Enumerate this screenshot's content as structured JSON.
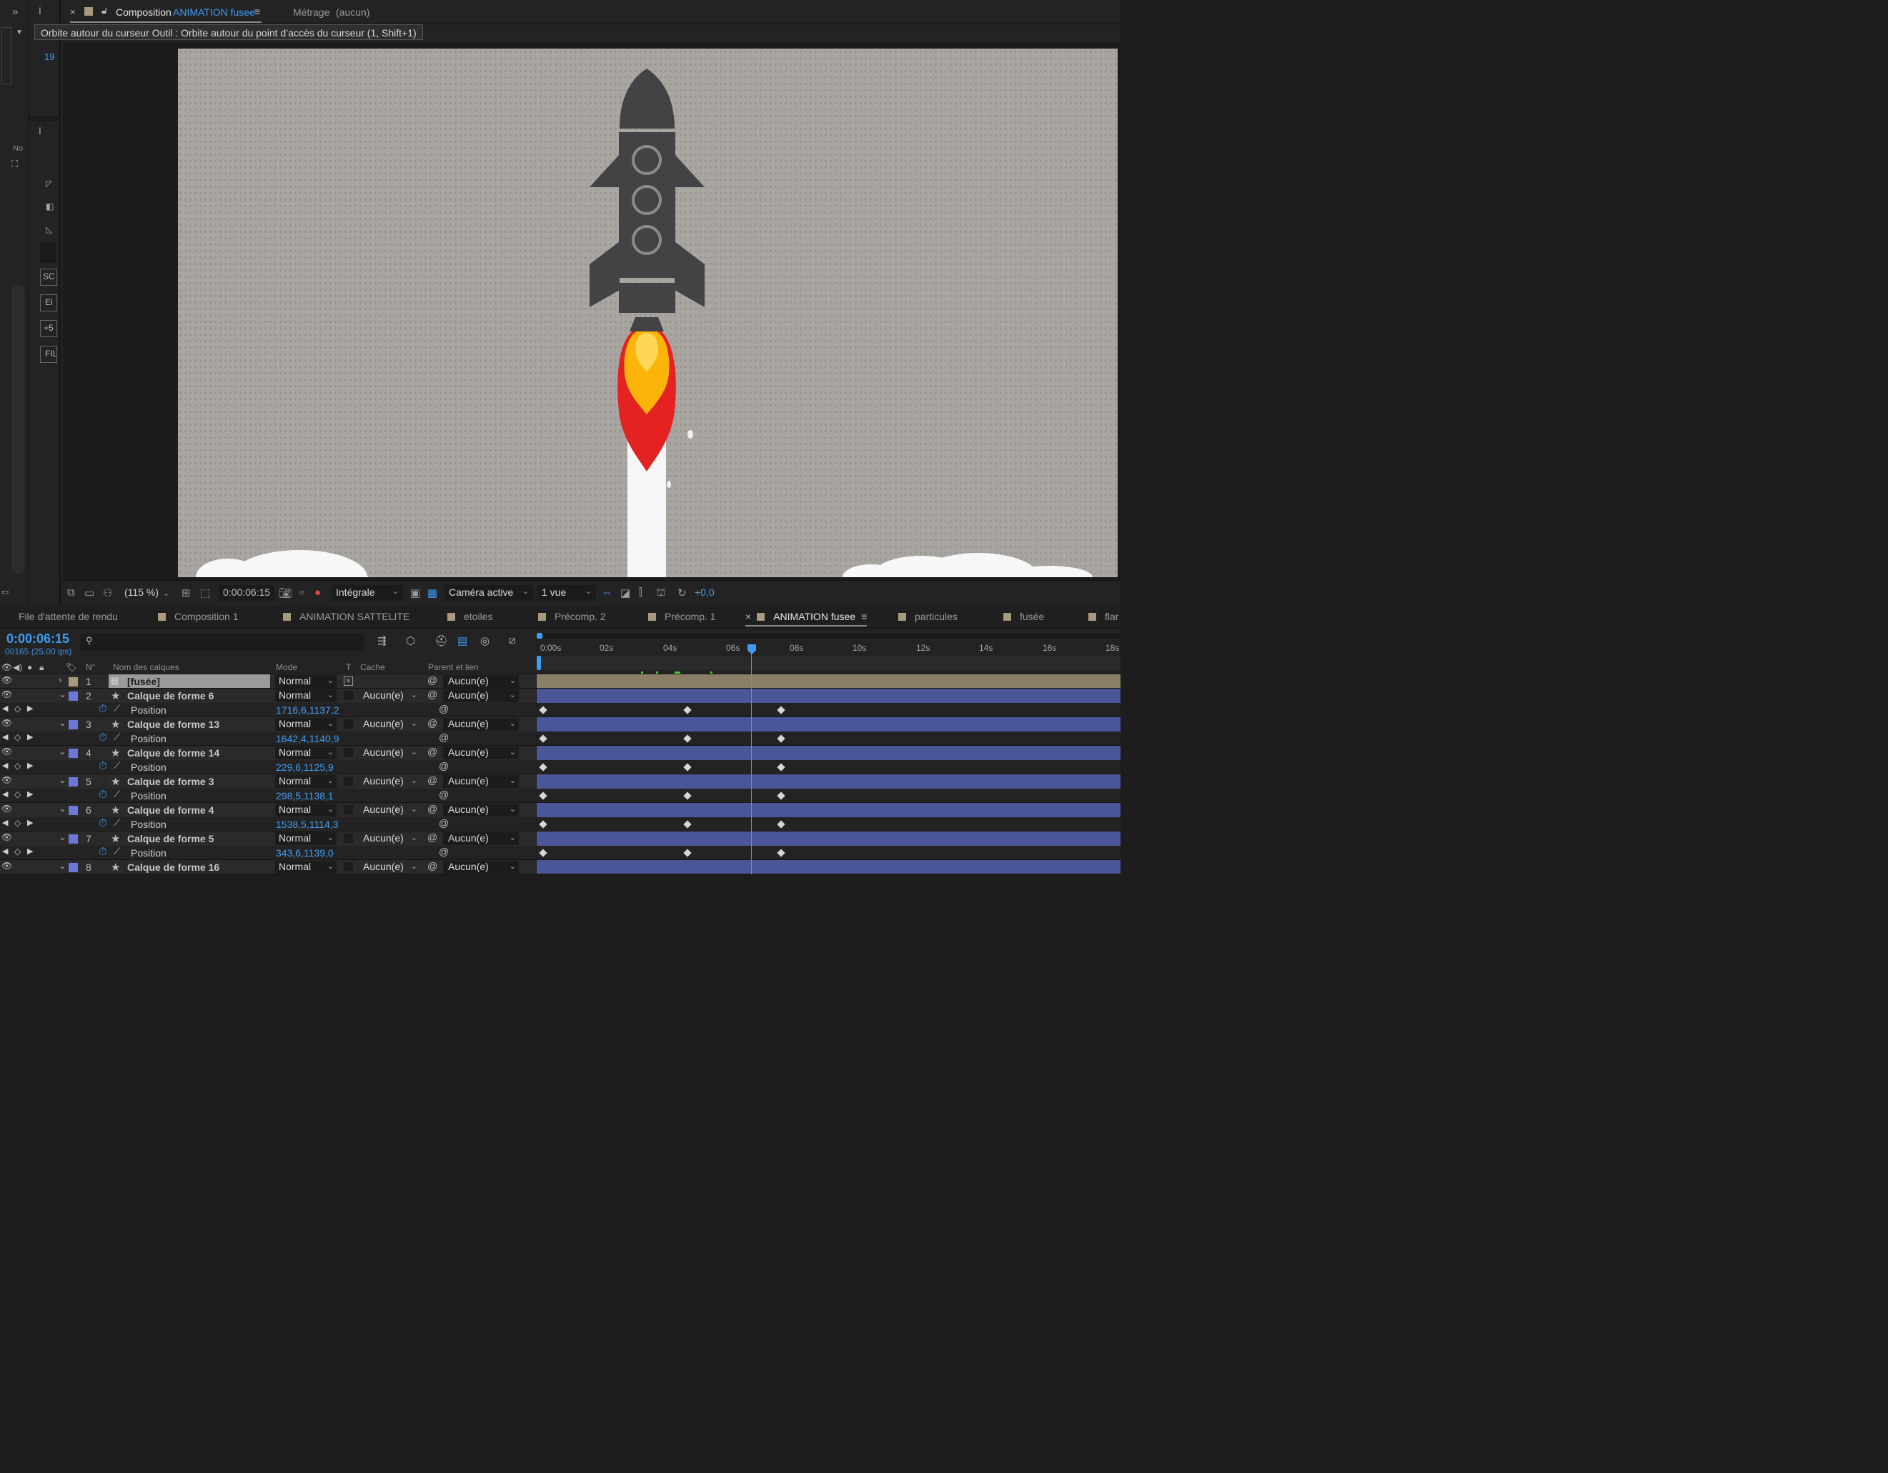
{
  "composition_panel": {
    "tab_prefix": "Composition",
    "tab_name": "ANIMATION fusee",
    "footage_tab": "Métrage",
    "footage_value": "(aucun)",
    "tooltip": "Orbite autour du curseur Outil : Orbite autour du point d’accès du curseur (1, Shift+1)"
  },
  "left_strip": {
    "number": "19",
    "col_label": "No",
    "buttons": [
      "SC",
      "El",
      "+5",
      "FIL"
    ]
  },
  "viewer_toolbar": {
    "zoom": "(115 %)",
    "timecode": "0:00:06:15",
    "resolution": "Intégrale",
    "camera": "Caméra active",
    "views": "1 vue",
    "exposure": "+0,0"
  },
  "timeline_tabs": [
    {
      "label": "File d'attente de rendu"
    },
    {
      "label": "Composition 1"
    },
    {
      "label": "ANIMATION SATTELITE"
    },
    {
      "label": "etoiles"
    },
    {
      "label": "Précomp. 2"
    },
    {
      "label": "Précomp. 1"
    },
    {
      "label": "ANIMATION fusee"
    },
    {
      "label": "particules"
    },
    {
      "label": "fusée"
    },
    {
      "label": "flar"
    }
  ],
  "timeline": {
    "timecode": "0:00:06:15",
    "frames": "00165 (25.00 ips)",
    "headers": {
      "num": "N°",
      "name": "Nom des calques",
      "mode": "Mode",
      "t": "T",
      "cache": "Cache",
      "parent": "Parent et lien"
    },
    "ruler": [
      "0:00s",
      "02s",
      "04s",
      "06s",
      "08s",
      "10s",
      "12s",
      "14s",
      "16s",
      "18s"
    ],
    "layers": [
      {
        "num": "1",
        "name": "[fusée]",
        "mode": "Normal",
        "parent": "Aucun(e)",
        "color": "#a89a7c"
      },
      {
        "num": "2",
        "name": "Calque de forme 6",
        "mode": "Normal",
        "cache": "Aucun(e)",
        "parent": "Aucun(e)",
        "color": "#6b78d8",
        "prop": "Position",
        "value": "1716,6,1137,2"
      },
      {
        "num": "3",
        "name": "Calque de forme 13",
        "mode": "Normal",
        "cache": "Aucun(e)",
        "parent": "Aucun(e)",
        "color": "#6b78d8",
        "prop": "Position",
        "value": "1642,4,1140,9"
      },
      {
        "num": "4",
        "name": "Calque de forme 14",
        "mode": "Normal",
        "cache": "Aucun(e)",
        "parent": "Aucun(e)",
        "color": "#6b78d8",
        "prop": "Position",
        "value": "229,6,1125,9"
      },
      {
        "num": "5",
        "name": "Calque de forme 3",
        "mode": "Normal",
        "cache": "Aucun(e)",
        "parent": "Aucun(e)",
        "color": "#6b78d8",
        "prop": "Position",
        "value": "298,5,1138,1"
      },
      {
        "num": "6",
        "name": "Calque de forme 4",
        "mode": "Normal",
        "cache": "Aucun(e)",
        "parent": "Aucun(e)",
        "color": "#6b78d8",
        "prop": "Position",
        "value": "1538,5,1114,3"
      },
      {
        "num": "7",
        "name": "Calque de forme 5",
        "mode": "Normal",
        "cache": "Aucun(e)",
        "parent": "Aucun(e)",
        "color": "#6b78d8",
        "prop": "Position",
        "value": "343,6,1139,0"
      },
      {
        "num": "8",
        "name": "Calque de forme 16",
        "mode": "Normal",
        "cache": "Aucun(e)",
        "parent": "Aucun(e)",
        "color": "#6b78d8"
      }
    ]
  },
  "colors": {
    "accent": "#3f9cf2",
    "layer_bar": "#4b5699",
    "footage_bar": "#8a7f66",
    "rocket_body": "#434345",
    "flame_red": "#e42222",
    "flame_orange": "#fbb40a"
  }
}
